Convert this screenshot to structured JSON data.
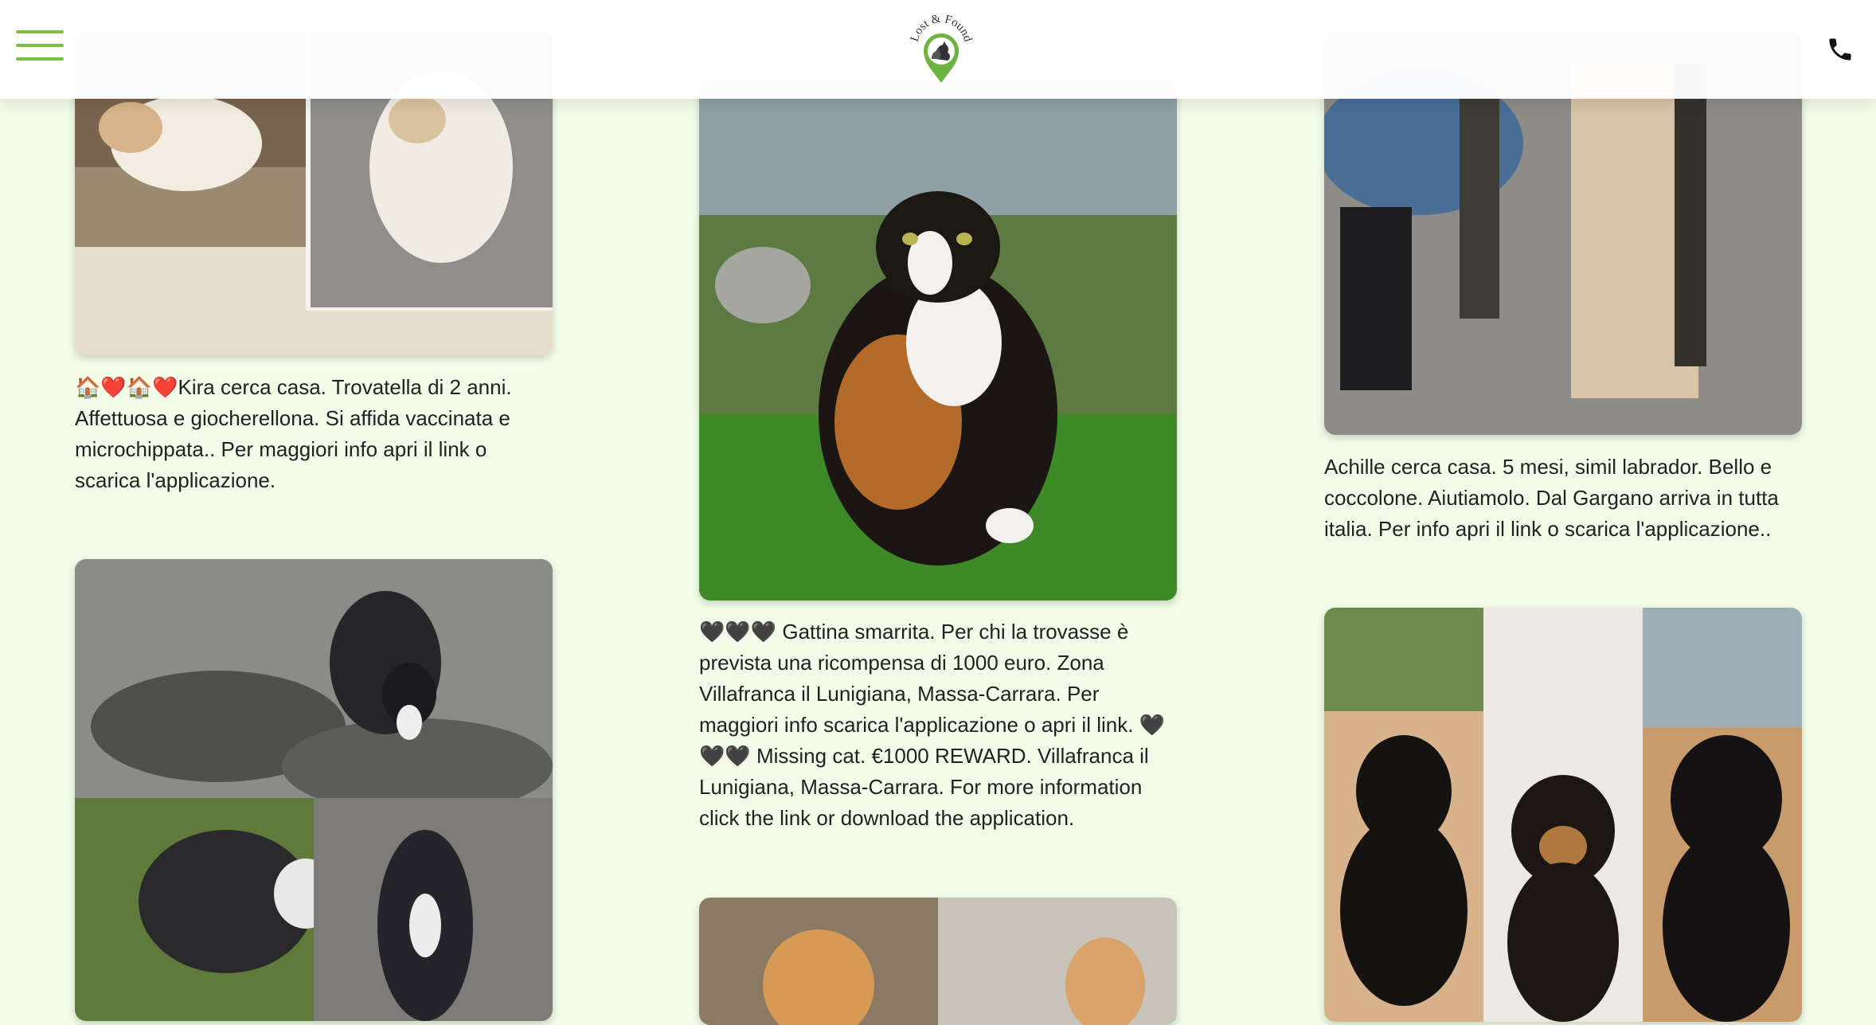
{
  "header": {
    "menu_icon": "hamburger-menu-icon",
    "logo_text": "Lost & Found",
    "phone_icon": "phone-icon"
  },
  "posts": [
    {
      "emoji_prefix": "🏠❤️🏠❤️",
      "text": "Kira cerca casa. Trovatella di 2 anni. Affettuosa e giocherellona. Si affida vaccinata e microchippata.. Per maggiori info apri il link o scarica l'applicazione."
    },
    {
      "text": "🖤🖤🖤 Gattina smarrita. Per chi la trovasse è prevista una ricompensa di 1000 euro. Zona Villafranca il Lunigiana, Massa-Carrara. Per maggiori info scarica l'applicazione o apri il link. 🖤🖤🖤 Missing cat. €1000 REWARD. Villafranca il Lunigiana, Massa-Carrara. For more information click the link or download the application."
    },
    {
      "text": "Achille cerca casa. 5 mesi, simil labrador. Bello e coccolone. Aiutiamolo. Dal Gargano arriva in tutta italia. Per info apri il link o scarica l'applicazione.."
    }
  ],
  "colors": {
    "background": "#f1fde9",
    "accent_green": "#7cbf45",
    "text": "#222222"
  }
}
